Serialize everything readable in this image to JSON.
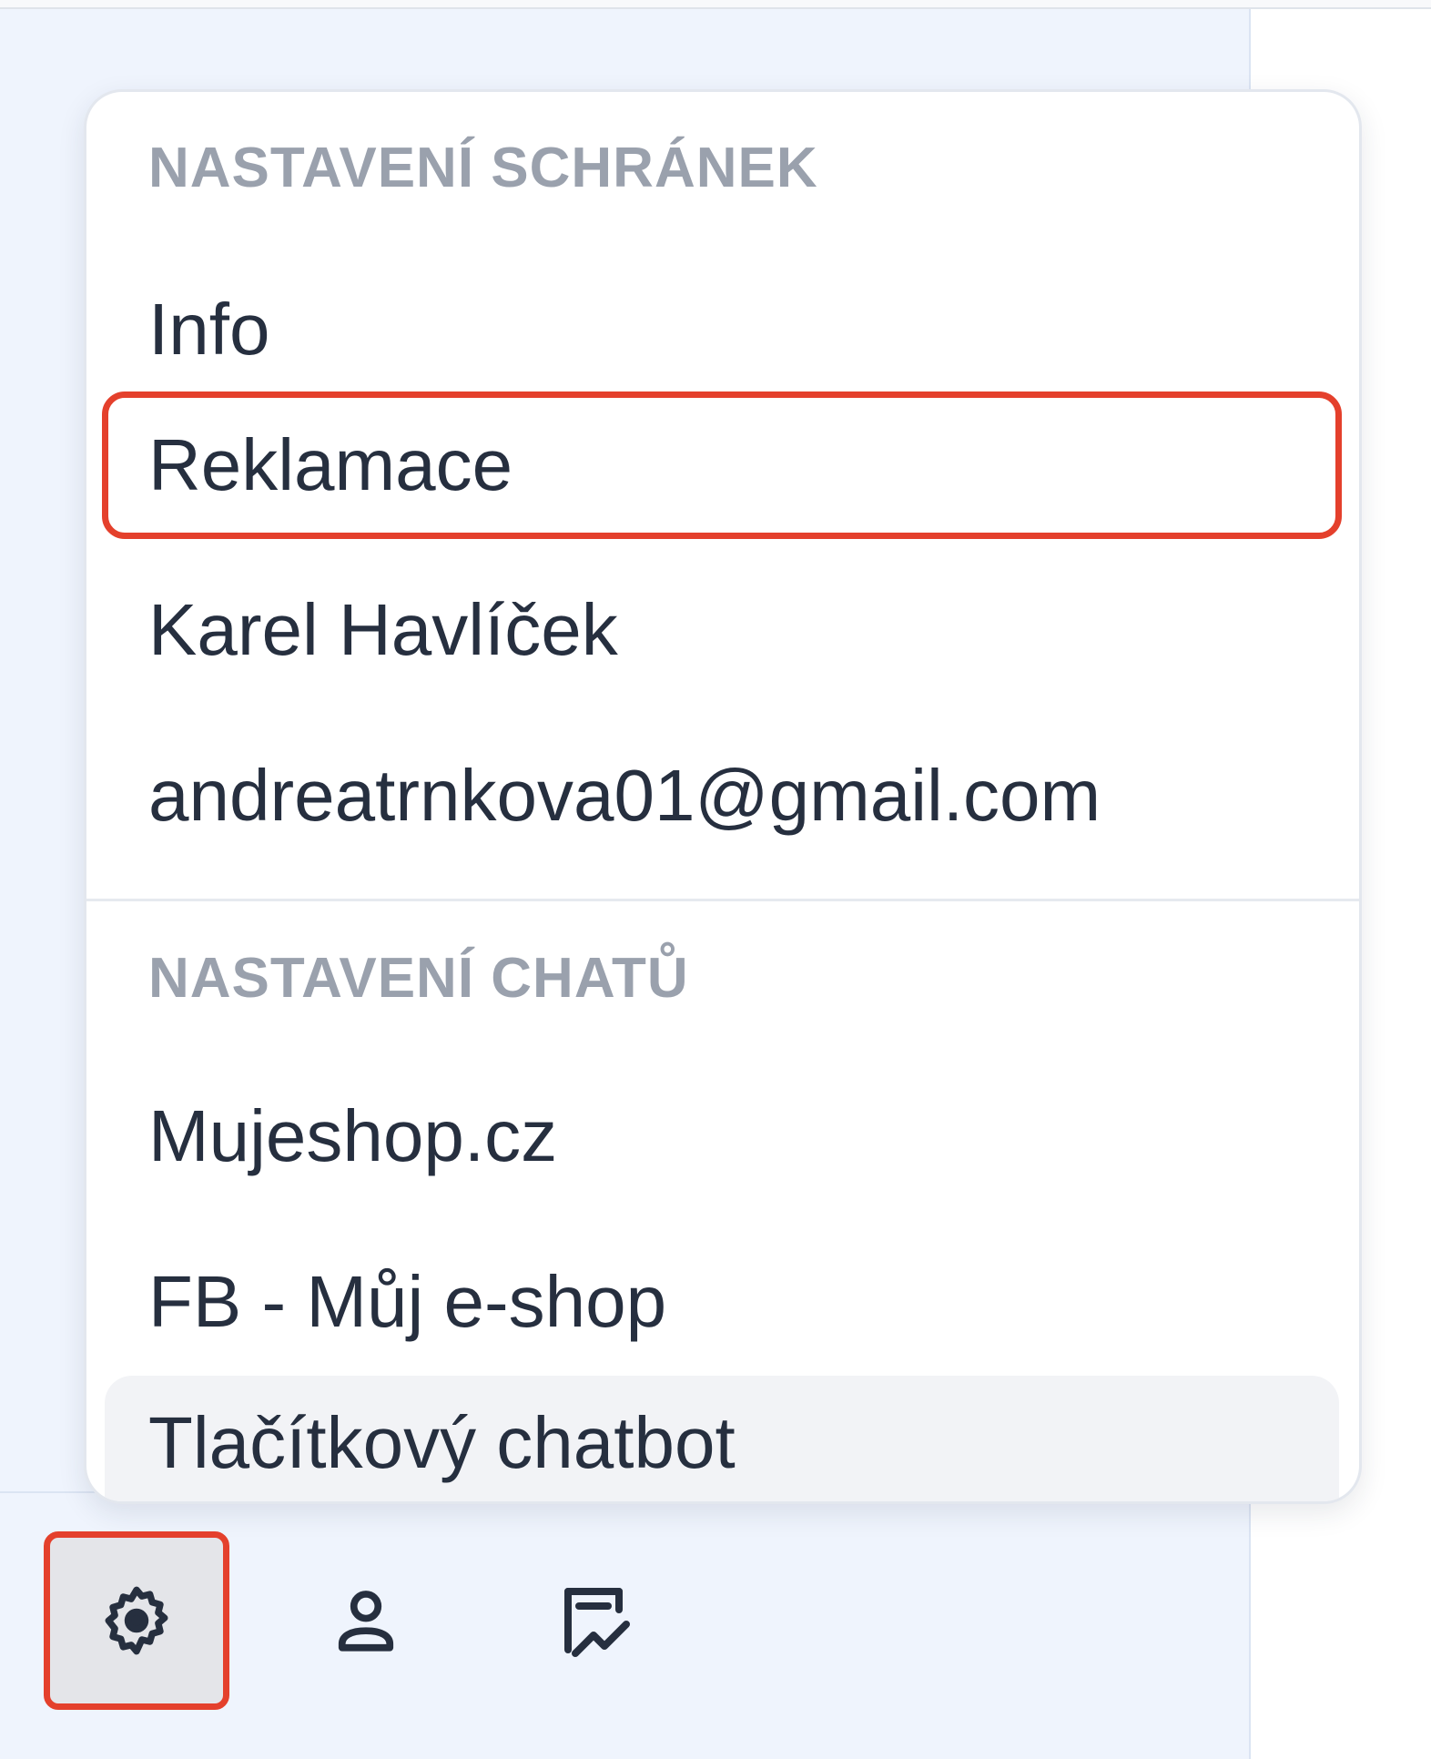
{
  "menu": {
    "sections": [
      {
        "header": "NASTAVENÍ SCHRÁNEK",
        "items": [
          "Info",
          "Reklamace",
          "Karel Havlíček",
          "andreatrnkova01@gmail.com"
        ]
      },
      {
        "header": "NASTAVENÍ CHATŮ",
        "items": [
          "Mujeshop.cz",
          "FB - Můj e-shop",
          "Tlačítkový chatbot"
        ]
      }
    ],
    "highlighted_item": "Reklamace",
    "hovered_item": "Tlačítkový chatbot"
  },
  "bottom_bar": {
    "buttons": [
      {
        "icon": "gear-icon",
        "active": true
      },
      {
        "icon": "user-icon",
        "active": false
      },
      {
        "icon": "chart-report-icon",
        "active": false
      }
    ]
  },
  "colors": {
    "highlight": "#e4402c",
    "sidebar_bg": "#eff4fd",
    "text": "#262f3f",
    "section_header": "#9aa1ad"
  }
}
